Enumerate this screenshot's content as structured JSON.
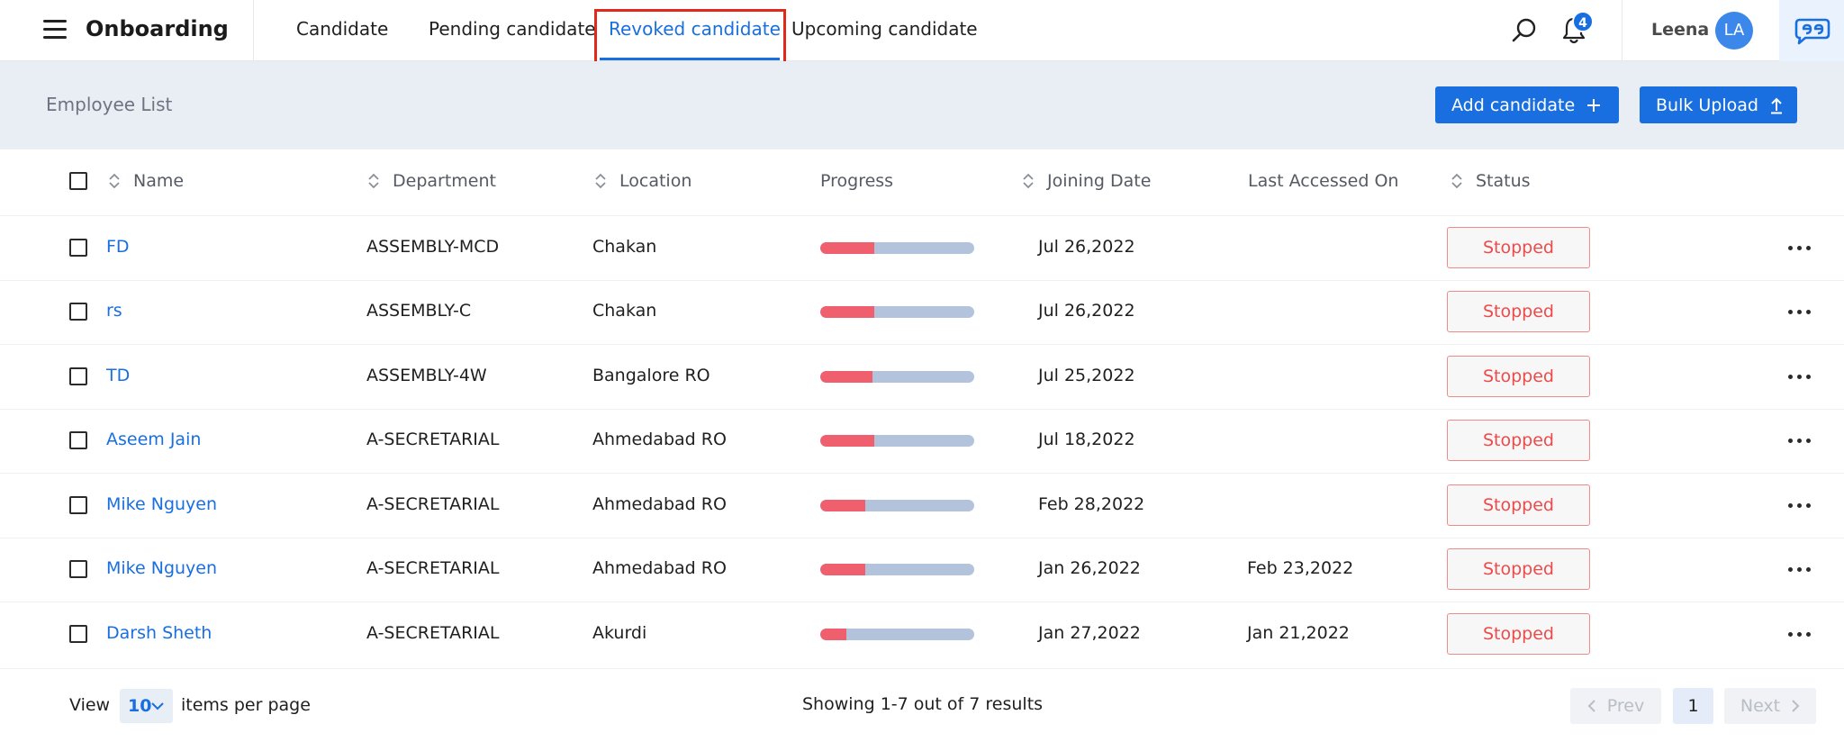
{
  "header": {
    "app_title": "Onboarding",
    "tabs": [
      {
        "label": "Candidate"
      },
      {
        "label": "Pending candidate"
      },
      {
        "label": "Revoked candidate",
        "active": true
      },
      {
        "label": "Upcoming candidate"
      }
    ],
    "notification_count": "4",
    "user_name": "Leena",
    "user_initials": "LA"
  },
  "list_header": {
    "title": "Employee List",
    "add_button": "Add candidate",
    "bulk_button": "Bulk Upload"
  },
  "table": {
    "columns": [
      "Name",
      "Department",
      "Location",
      "Progress",
      "Joining Date",
      "Last Accessed On",
      "Status"
    ],
    "rows": [
      {
        "name": "FD",
        "department": "ASSEMBLY-MCD",
        "location": "Chakan",
        "progress": 0.35,
        "joining_date": "Jul 26,2022",
        "last_accessed": "",
        "status": "Stopped"
      },
      {
        "name": "rs",
        "department": "ASSEMBLY-C",
        "location": "Chakan",
        "progress": 0.35,
        "joining_date": "Jul 26,2022",
        "last_accessed": "",
        "status": "Stopped"
      },
      {
        "name": "TD",
        "department": "ASSEMBLY-4W",
        "location": "Bangalore RO",
        "progress": 0.34,
        "joining_date": "Jul 25,2022",
        "last_accessed": "",
        "status": "Stopped"
      },
      {
        "name": "Aseem Jain",
        "department": "A-SECRETARIAL",
        "location": "Ahmedabad RO",
        "progress": 0.35,
        "joining_date": "Jul 18,2022",
        "last_accessed": "",
        "status": "Stopped"
      },
      {
        "name": "Mike Nguyen",
        "department": "A-SECRETARIAL",
        "location": "Ahmedabad RO",
        "progress": 0.29,
        "joining_date": "Feb 28,2022",
        "last_accessed": "",
        "status": "Stopped"
      },
      {
        "name": "Mike Nguyen",
        "department": "A-SECRETARIAL",
        "location": "Ahmedabad RO",
        "progress": 0.29,
        "joining_date": "Jan 26,2022",
        "last_accessed": "Feb 23,2022",
        "status": "Stopped"
      },
      {
        "name": "Darsh Sheth",
        "department": "A-SECRETARIAL",
        "location": "Akurdi",
        "progress": 0.17,
        "joining_date": "Jan 27,2022",
        "last_accessed": "Jan 21,2022",
        "status": "Stopped"
      }
    ]
  },
  "footer": {
    "view_label": "View",
    "per_page_value": "10",
    "per_page_suffix": "items per page",
    "showing_text": "Showing 1-7 out of 7 results",
    "prev_label": "Prev",
    "current_page": "1",
    "next_label": "Next"
  },
  "colors": {
    "accent": "#1a6fe0",
    "status_stopped": "#ee4a4a",
    "progress_fill": "#ef5f6e",
    "progress_track": "#b3c3db",
    "highlight_box": "#e0281b"
  },
  "icons": [
    "hamburger-icon",
    "search-icon",
    "bell-icon",
    "brand-logo-icon",
    "plus-icon",
    "upload-icon",
    "sort-icon",
    "more-icon",
    "chevron-down-icon",
    "chevron-left-icon",
    "chevron-right-icon"
  ]
}
